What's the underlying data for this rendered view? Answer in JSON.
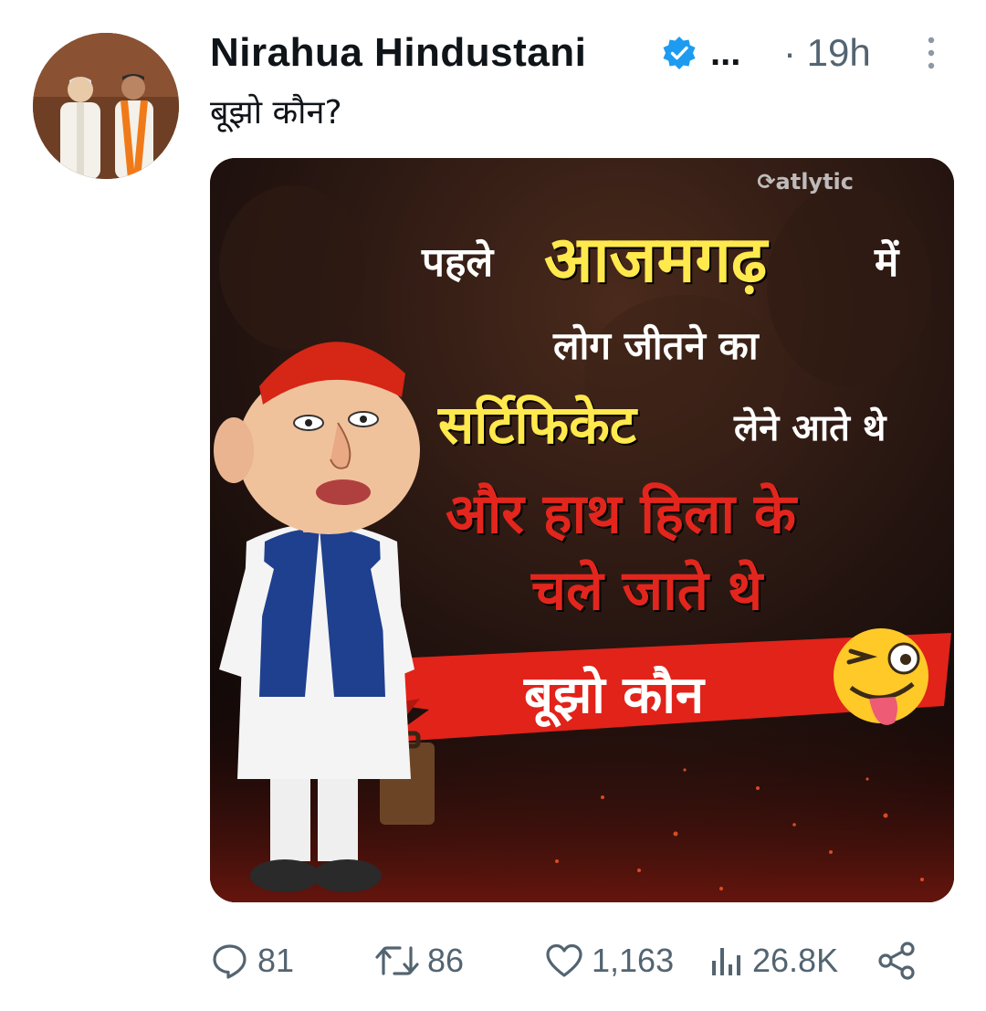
{
  "tweet": {
    "author_name": "Nirahua Hindustani",
    "more_handle": "...",
    "time": "· 19h",
    "text": "बूझो कौन?"
  },
  "media": {
    "watermark": "atlytic",
    "line1_prefix": "पहले",
    "line1_highlight": "आजमगढ़",
    "line1_suffix": "में",
    "line2": "लोग जीतने का",
    "line3_highlight": "सर्टिफिकेट",
    "line3_rest": "लेने आते थे",
    "line4": "और हाथ हिला के",
    "line5": "चले जाते थे",
    "quiz_label": "बूझो कौन",
    "emoji": "winking-tongue-face"
  },
  "actions": {
    "replies": "81",
    "retweets": "86",
    "likes": "1,163",
    "views": "26.8K"
  },
  "colors": {
    "text_primary": "#0f1419",
    "text_secondary": "#536471",
    "verified": "#1d9bf0",
    "headline_yellow": "#ffe94d",
    "headline_red": "#e3261d"
  },
  "icons": [
    "verified-badge-icon",
    "more-options-icon",
    "reply-icon",
    "retweet-icon",
    "like-icon",
    "views-icon",
    "share-icon"
  ]
}
